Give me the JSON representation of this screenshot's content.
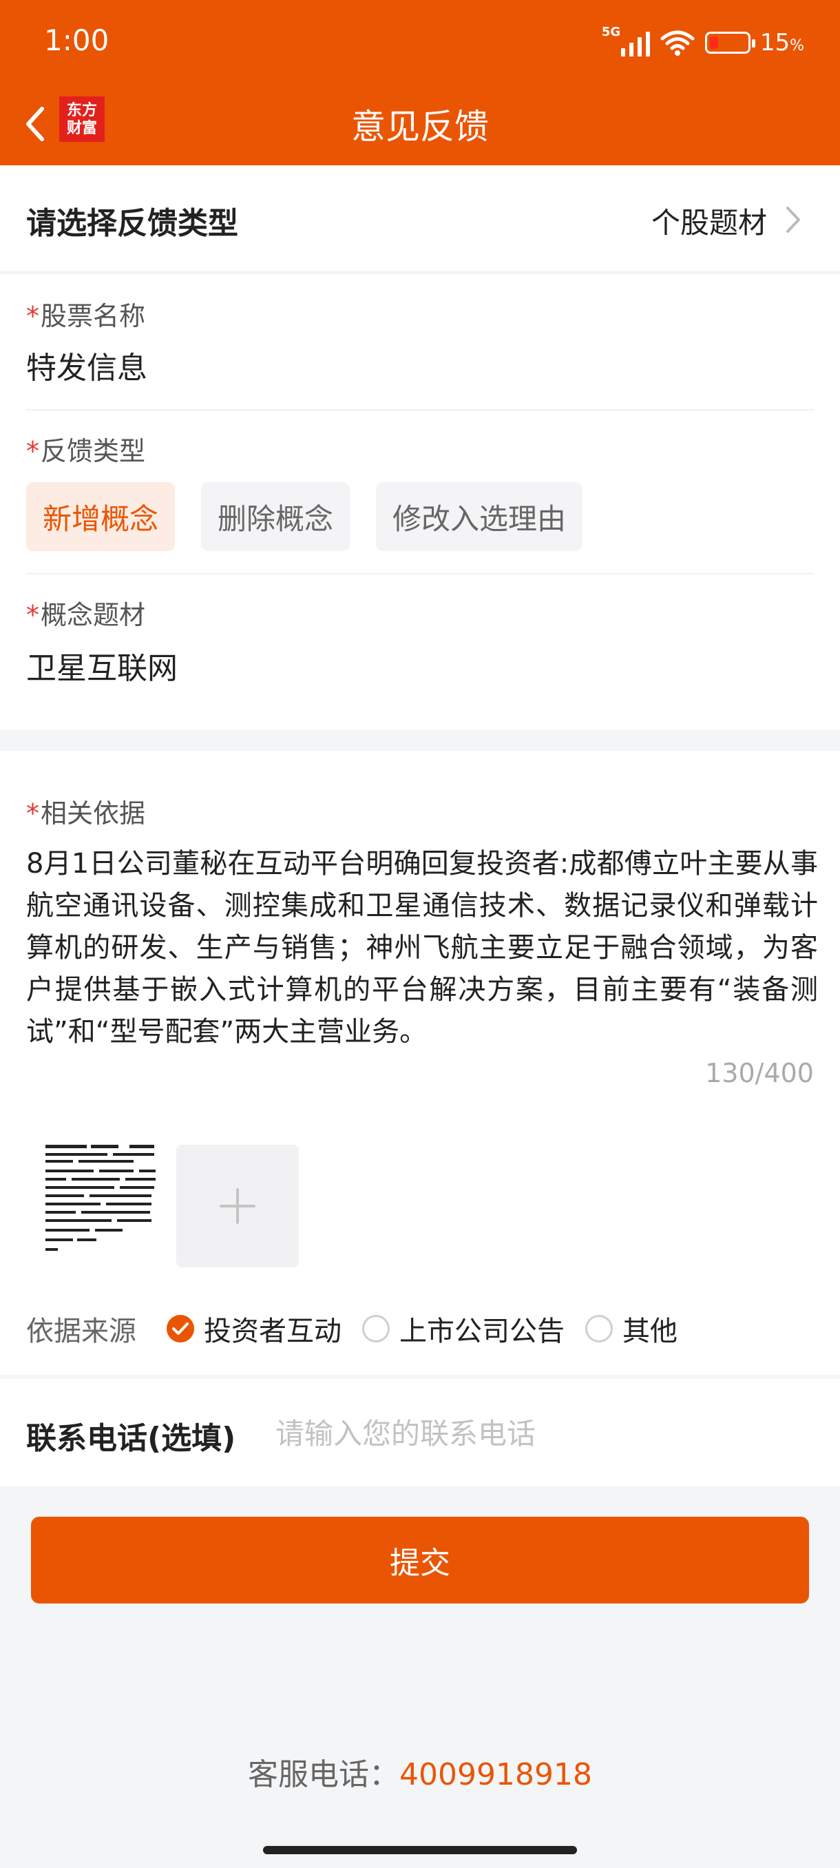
{
  "status_bar": {
    "time": "1:00",
    "network": "5G",
    "battery_value": "15",
    "battery_unit": "%",
    "battery_level": 0.15
  },
  "header": {
    "title": "意见反馈",
    "logo_line1": "东方",
    "logo_line2": "财富"
  },
  "feedback_type": {
    "label": "请选择反馈类型",
    "value": "个股题材"
  },
  "stock_name": {
    "star": "*",
    "label": "股票名称",
    "value": "特发信息"
  },
  "feedback_kind": {
    "star": "*",
    "label": "反馈类型",
    "options": [
      "新增概念",
      "删除概念",
      "修改入选理由"
    ],
    "selected": "新增概念"
  },
  "concept": {
    "star": "*",
    "label": "概念题材",
    "value": "卫星互联网"
  },
  "basis": {
    "star": "*",
    "label": "相关依据",
    "text": "8月1日公司董秘在互动平台明确回复投资者:成都傅立叶主要从事航空通讯设备、测控集成和卫星通信技术、数据记录仪和弹载计算机的研发、生产与销售；神州飞航主要立足于融合领域，为客户提供基于嵌入式计算机的平台解决方案，目前主要有“装备测试”和“型号配套”两大主营业务。",
    "counter": "130/400"
  },
  "source": {
    "label": "依据来源",
    "options": [
      "投资者互动",
      "上市公司公告",
      "其他"
    ],
    "selected": "投资者互动"
  },
  "phone": {
    "label": "联系电话(选填)",
    "placeholder": "请输入您的联系电话",
    "value": ""
  },
  "submit_label": "提交",
  "service": {
    "label": "客服电话：",
    "number": "4009918918"
  },
  "colors": {
    "accent": "#ea5504",
    "required": "#e53935",
    "chip_active_bg": "#fdece3"
  },
  "icons": {
    "back": "chevron-left-icon",
    "chevron": "chevron-right-icon",
    "add": "plus-icon",
    "check": "check-icon"
  }
}
